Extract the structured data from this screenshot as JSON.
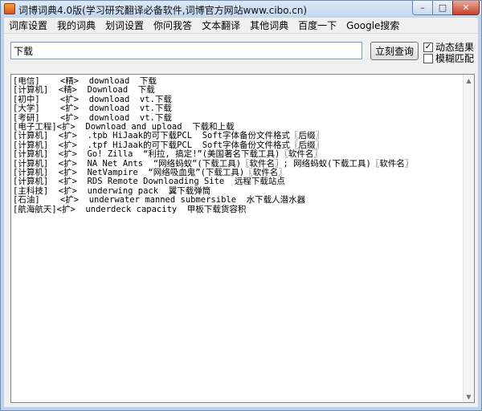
{
  "window": {
    "title": "词博词典4.0版(学习研究翻译必备软件,词博官方网站www.cibo.cn)",
    "minimize_glyph": "–",
    "maximize_glyph": "□",
    "close_glyph": "✕"
  },
  "menu": [
    {
      "label": "词库设置"
    },
    {
      "label": "我的词典"
    },
    {
      "label": "划词设置"
    },
    {
      "label": "你问我答"
    },
    {
      "label": "文本翻译"
    },
    {
      "label": "其他词典"
    },
    {
      "label": "百度一下"
    },
    {
      "label": "Google搜索"
    }
  ],
  "search": {
    "value": "下载",
    "button_label": "立刻查询"
  },
  "options": [
    {
      "label": "动态结果",
      "checked": true,
      "mark": "✓"
    },
    {
      "label": "模糊匹配",
      "checked": false,
      "mark": ""
    }
  ],
  "results": [
    {
      "text": "[电信]    <精>  download  下载"
    },
    {
      "text": "[计算机]  <精>  Download  下载"
    },
    {
      "text": "[初中]    <扩>  download  vt.下载"
    },
    {
      "text": "[大学]    <扩>  download  vt.下载"
    },
    {
      "text": "[考研]    <扩>  download  vt.下载"
    },
    {
      "text": "[电子工程]<扩>  Download and upload  下载和上载"
    },
    {
      "text": "[计算机]  <扩>  .tpb HiJaak的可下载PCL  Soft字体备份文件格式〖后缀〗"
    },
    {
      "text": "[计算机]  <扩>  .tpf HiJaak的可下载PCL  Soft字体备份文件格式〖后缀〗"
    },
    {
      "text": "[计算机]  <扩>  Go! Zilla  “利拉, 搞定!”(美国著名下载工具)〖软件名〗"
    },
    {
      "text": "[计算机]  <扩>  NA Net Ants  “网络蚂蚁”(下载工具)〖软件名〗; 网络蚂蚁(下载工具)〖软件名〗"
    },
    {
      "text": "[计算机]  <扩>  NetVampire  “网络吸血鬼”(下载工具)〖软件名〗"
    },
    {
      "text": "[计算机]  <扩>  RDS Remote Downloading Site  远程下载站点"
    },
    {
      "text": "[主科技]  <扩>  underwing pack  翼下载弹筒"
    },
    {
      "text": "[石油]    <扩>  underwater manned submersible  水下载人潜水器"
    },
    {
      "text": "[航海航天]<扩>  underdeck capacity  甲板下载货容积"
    }
  ],
  "scrollbar": {
    "up_glyph": "▲",
    "down_glyph": "▼"
  }
}
